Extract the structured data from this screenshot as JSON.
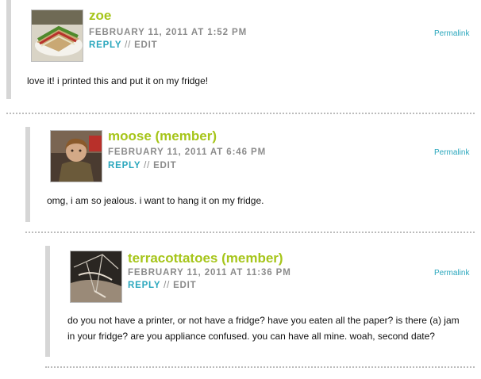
{
  "comments": [
    {
      "author": "zoe",
      "date": "FEBRUARY 11, 2011 AT 1:52 PM",
      "reply": "REPLY",
      "separator": "//",
      "edit": "EDIT",
      "permalink": "Permalink",
      "body": "love it! i printed this and put it on my fridge!",
      "avatar_icon": "sandwich-photo-icon"
    },
    {
      "author": "moose (member)",
      "date": "FEBRUARY 11, 2011 AT 6:46 PM",
      "reply": "REPLY",
      "separator": "//",
      "edit": "EDIT",
      "permalink": "Permalink",
      "body": "omg, i am so jealous. i want to hang it on my fridge.",
      "avatar_icon": "person-photo-icon"
    },
    {
      "author": "terracottatoes (member)",
      "date": "FEBRUARY 11, 2011 AT 11:36 PM",
      "reply": "REPLY",
      "separator": "//",
      "edit": "EDIT",
      "permalink": "Permalink",
      "body": "do you not have a printer, or not have a fridge? have you eaten all the paper? is there (a) jam in your fridge? are you appliance confused. you can have all mine. woah, second date?",
      "avatar_icon": "umbrella-photo-icon"
    }
  ],
  "colors": {
    "author": "#a6c51a",
    "link": "#2aa7bd",
    "meta": "#8b8b8b",
    "bar": "#d6d6d6"
  }
}
